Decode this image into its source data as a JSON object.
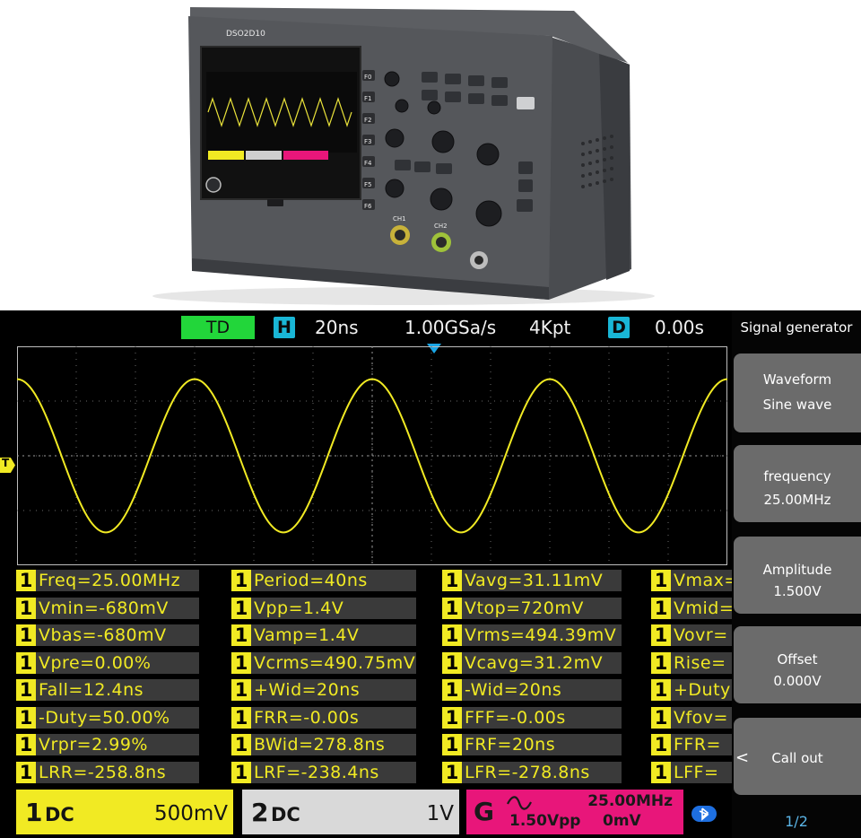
{
  "device": {
    "model_label": "DSO2D10",
    "softkeys": [
      "F0",
      "F1",
      "F2",
      "F3",
      "F4",
      "F5",
      "F6"
    ],
    "channel_labels": [
      "CH1",
      "CH2"
    ]
  },
  "topbar": {
    "mode": "TD",
    "horizontal_badge": "H",
    "timebase": "20ns",
    "sample_rate": "1.00GSa/s",
    "memory_depth": "4Kpt",
    "delay_badge": "D",
    "delay": "0.00s"
  },
  "trigger": {
    "level_label": "T"
  },
  "waveform": {
    "color": "#f1ea23",
    "cycles": 4,
    "amplitude_fraction": 0.7
  },
  "measurements": [
    [
      "Freq=25.00MHz",
      "Period=40ns",
      "Vavg=31.11mV",
      "Vmax="
    ],
    [
      "Vmin=-680mV",
      "Vpp=1.4V",
      "Vtop=720mV",
      "Vmid="
    ],
    [
      "Vbas=-680mV",
      "Vamp=1.4V",
      "Vrms=494.39mV",
      "Vovr="
    ],
    [
      "Vpre=0.00%",
      "Vcrms=490.75mV",
      "Vcavg=31.2mV",
      "Rise="
    ],
    [
      "Fall=12.4ns",
      "+Wid=20ns",
      "-Wid=20ns",
      "+Duty"
    ],
    [
      "-Duty=50.00%",
      "FRR=-0.00s",
      "FFF=-0.00s",
      "Vfov="
    ],
    [
      "Vrpr=2.99%",
      "BWid=278.8ns",
      "FRF=20ns",
      "FFR="
    ],
    [
      "LRR=-258.8ns",
      "LRF=-238.4ns",
      "LFR=-278.8ns",
      "LFF="
    ]
  ],
  "measurement_channel": "1",
  "menu": {
    "title": "Signal generator",
    "items": [
      {
        "label": "Waveform",
        "value": "Sine wave"
      },
      {
        "label": "frequency",
        "value": "25.00MHz"
      },
      {
        "label": "Amplitude",
        "value": "1.500V"
      },
      {
        "label": "Offset",
        "value": "0.000V"
      },
      {
        "label": "Call out",
        "value": ""
      }
    ],
    "page": "1/2"
  },
  "channels": {
    "ch1": {
      "number": "1",
      "coupling": "DC",
      "scale": "500mV"
    },
    "ch2": {
      "number": "2",
      "coupling": "DC",
      "scale": "1V"
    },
    "gen": {
      "letter": "G",
      "frequency": "25.00MHz",
      "amplitude": "1.50Vpp",
      "offset": "0mV"
    }
  },
  "colors": {
    "ch1": "#f1ea23",
    "ch2": "#d9d9d9",
    "generator": "#e8167a",
    "mode_badge": "#22d63a",
    "info_badge": "#19b6d6",
    "menu_button": "#6b6b6b"
  }
}
